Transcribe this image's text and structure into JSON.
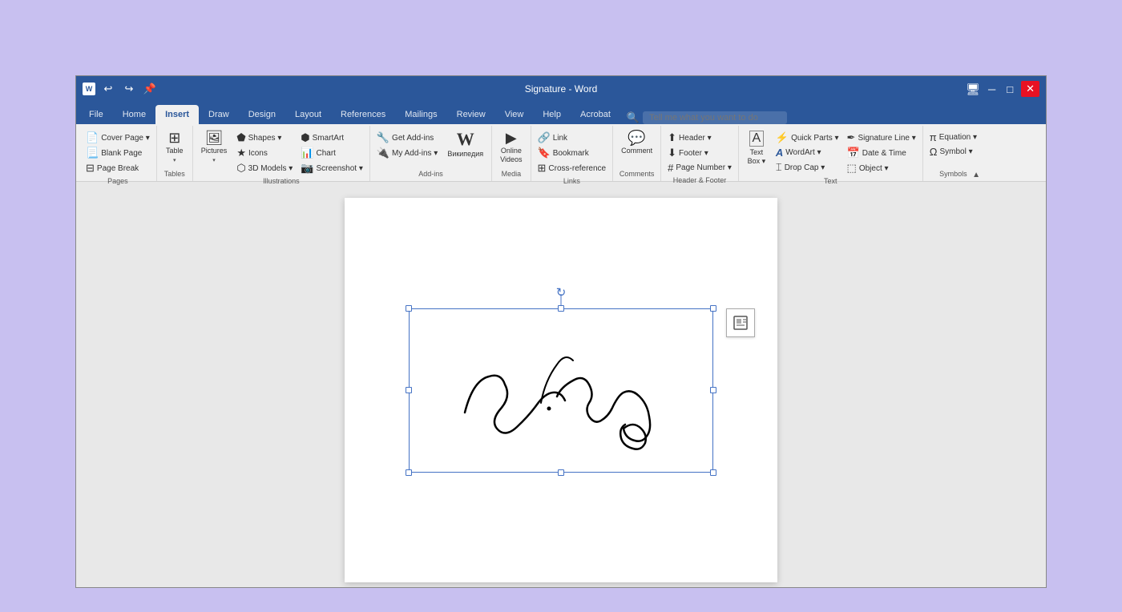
{
  "window": {
    "title": "Signature - Word",
    "titlebar_left_icon": "W"
  },
  "tabs": [
    {
      "label": "File",
      "active": false
    },
    {
      "label": "Home",
      "active": false
    },
    {
      "label": "Insert",
      "active": true
    },
    {
      "label": "Draw",
      "active": false
    },
    {
      "label": "Design",
      "active": false
    },
    {
      "label": "Layout",
      "active": false
    },
    {
      "label": "References",
      "active": false
    },
    {
      "label": "Mailings",
      "active": false
    },
    {
      "label": "Review",
      "active": false
    },
    {
      "label": "View",
      "active": false
    },
    {
      "label": "Help",
      "active": false
    },
    {
      "label": "Acrobat",
      "active": false
    }
  ],
  "search_placeholder": "Tell me what you want to do",
  "groups": {
    "pages": {
      "label": "Pages",
      "items": [
        "Cover Page ▾",
        "Blank Page",
        "Page Break"
      ]
    },
    "tables": {
      "label": "Tables",
      "table_label": "Table"
    },
    "illustrations": {
      "label": "Illustrations",
      "items": [
        "Pictures",
        "Shapes ▾",
        "Icons",
        "3D Models ▾",
        "SmartArt",
        "Chart",
        "Screenshot ▾"
      ]
    },
    "addins": {
      "label": "Add-ins",
      "items": [
        "Get Add-ins",
        "My Add-ins ▾",
        "Википедия"
      ]
    },
    "media": {
      "label": "Media",
      "items": [
        "Online Videos"
      ]
    },
    "links": {
      "label": "Links",
      "items": [
        "Link",
        "Bookmark",
        "Cross-reference"
      ]
    },
    "comments": {
      "label": "Comments",
      "comment_label": "Comment"
    },
    "header_footer": {
      "label": "Header & Footer",
      "items": [
        "Header ▾",
        "Footer ▾",
        "Page Number ▾"
      ]
    },
    "text": {
      "label": "Text",
      "items": [
        "Text Box ▾",
        "Quick Parts ▾",
        "WordArt ▾",
        "Drop Cap ▾",
        "Signature Line ▾",
        "Date & Time",
        "Object ▾"
      ]
    },
    "symbols": {
      "label": "Symbols",
      "items": [
        "Equation ▾",
        "Symbol ▾"
      ]
    }
  },
  "signature": {
    "title": "Signature image"
  }
}
